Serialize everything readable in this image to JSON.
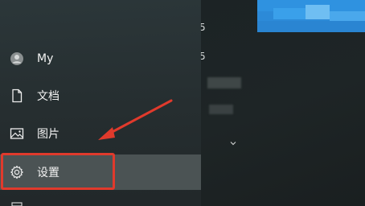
{
  "start_menu": {
    "items": [
      {
        "label": "My",
        "icon": "user-avatar-icon"
      },
      {
        "label": "文档",
        "icon": "document-icon"
      },
      {
        "label": "图片",
        "icon": "image-icon"
      },
      {
        "label": "设置",
        "icon": "gear-icon",
        "selected": true
      },
      {
        "label": "",
        "icon": ""
      }
    ]
  },
  "background_fragments": {
    "frag1": "5",
    "frag2": "5"
  },
  "annotation": {
    "color": "#e03a2c"
  }
}
